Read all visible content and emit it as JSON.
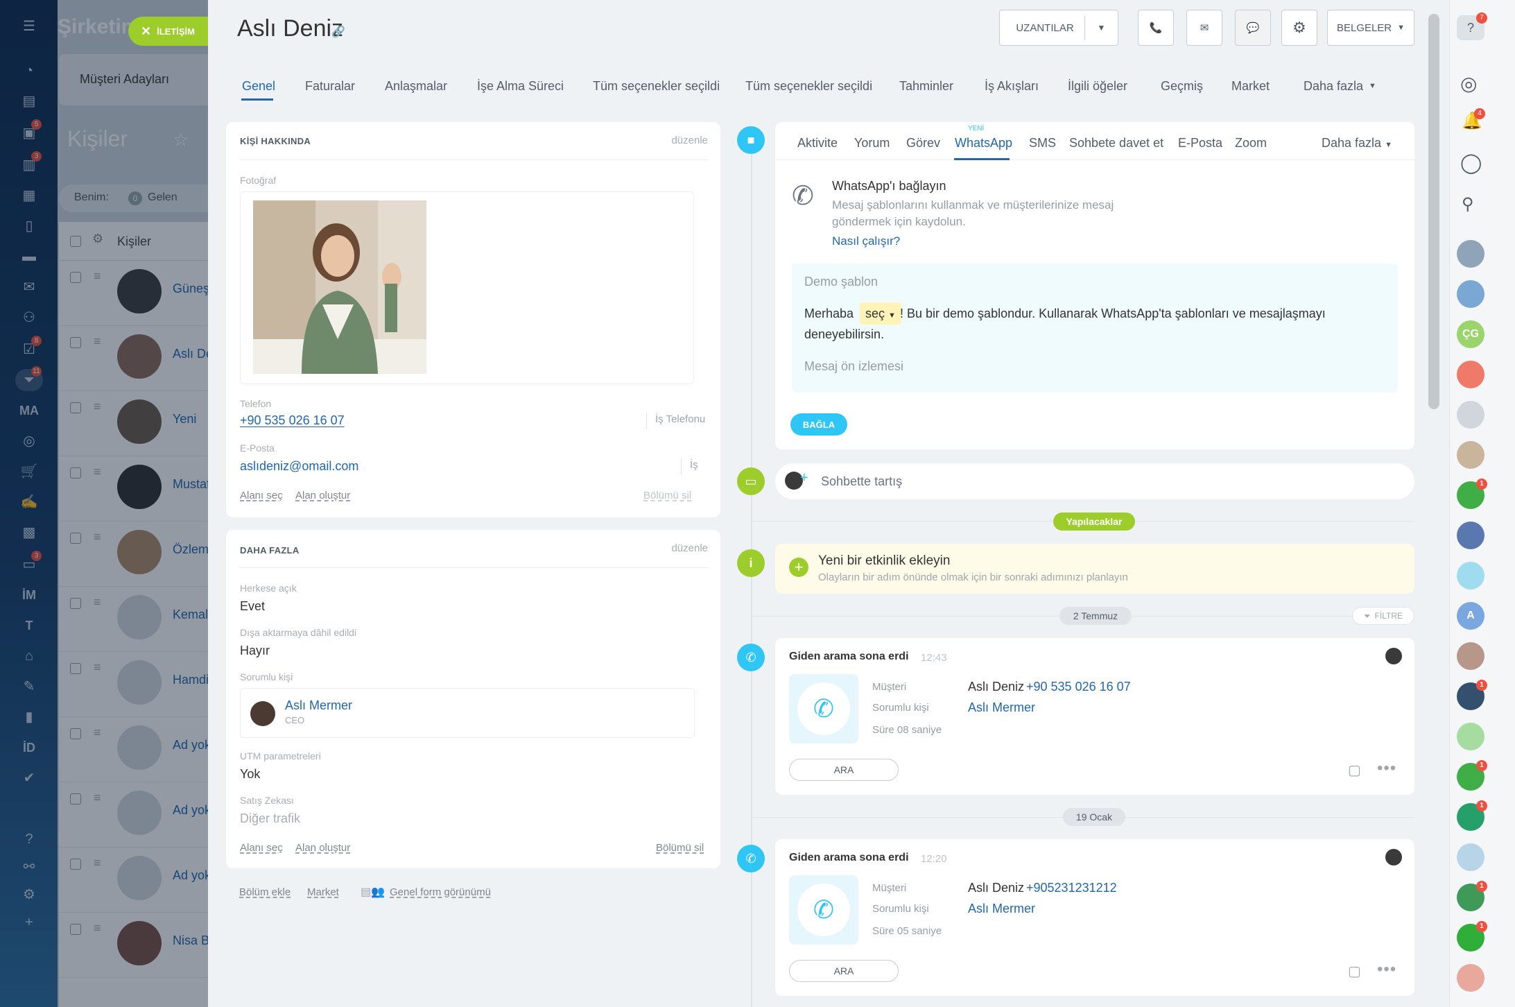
{
  "app": {
    "brand": "Şirketim",
    "contact_badge": "İLETİŞİM"
  },
  "leftnav": {
    "items": [
      {
        "icon": "menu-icon"
      },
      {
        "icon": "pie-chart-icon"
      },
      {
        "icon": "feed-icon"
      },
      {
        "icon": "chat-icon",
        "badge": "5"
      },
      {
        "icon": "contact-card-icon",
        "badge": "3"
      },
      {
        "icon": "calendar-icon"
      },
      {
        "icon": "document-icon"
      },
      {
        "icon": "drive-icon"
      },
      {
        "icon": "mail-icon"
      },
      {
        "icon": "groups-icon"
      },
      {
        "icon": "tasks-icon",
        "badge": "8"
      },
      {
        "icon": "crm-filter-icon",
        "badge": "11"
      },
      {
        "icon": "marketing-icon",
        "text": "MA"
      },
      {
        "icon": "target-icon"
      },
      {
        "icon": "cart-icon"
      },
      {
        "icon": "sign-icon"
      },
      {
        "icon": "box-icon"
      },
      {
        "icon": "inbox-icon",
        "badge": "3"
      },
      {
        "icon": "im-icon",
        "text": "İM"
      },
      {
        "icon": "text-icon",
        "text": "T"
      },
      {
        "icon": "bank-icon"
      },
      {
        "icon": "edit-doc-icon"
      },
      {
        "icon": "analytics-icon"
      },
      {
        "icon": "id-icon",
        "text": "İD"
      },
      {
        "icon": "check-icon"
      },
      {
        "icon": "help-icon"
      },
      {
        "icon": "structure-icon"
      },
      {
        "icon": "settings-icon"
      },
      {
        "icon": "plus-icon"
      }
    ]
  },
  "bgpage": {
    "leads_tab": "Müşteri Adayları",
    "title": "Kişiler",
    "filter_label": "Benim:",
    "filter_count": "0",
    "filter_text": "Gelen",
    "list_header": "Kişiler",
    "rows": [
      "Güneş",
      "Aslı De",
      "Yeni",
      "Mustaf",
      "Özlem",
      "Kemal",
      "Hamdi",
      "Ad yok",
      "Ad yok",
      "Ad yok",
      "Nisa Bu"
    ]
  },
  "header": {
    "title": "Aslı Deniz",
    "btn_extensions": "UZANTILAR",
    "btn_documents": "BELGELER"
  },
  "tabs": [
    "Genel",
    "Faturalar",
    "Anlaşmalar",
    "İşe Alma Süreci",
    "Tüm seçenekler seçildi",
    "Tüm seçenekler seçildi",
    "Tahminler",
    "İş Akışları",
    "İlgili öğeler",
    "Geçmiş",
    "Market",
    "Daha fazla"
  ],
  "about": {
    "title": "KİŞİ HAKKINDA",
    "edit": "düzenle",
    "photo_label": "Fotoğraf",
    "phone_label": "Telefon",
    "phone": "+90 535 026 16 07",
    "phone_type": "İş Telefonu",
    "email_label": "E-Posta",
    "email": "aslıdeniz@omail.com",
    "email_type": "İş",
    "select_field": "Alanı seç",
    "create_field": "Alan oluştur",
    "delete_section": "Bölümü sil"
  },
  "more": {
    "title": "DAHA FAZLA",
    "edit": "düzenle",
    "public_label": "Herkese açık",
    "public_value": "Evet",
    "export_label": "Dışa aktarmaya dâhil edildi",
    "export_value": "Hayır",
    "responsible_label": "Sorumlu kişi",
    "responsible_name": "Aslı Mermer",
    "responsible_role": "CEO",
    "utm_label": "UTM parametreleri",
    "utm_value": "Yok",
    "sales_label": "Satış Zekası",
    "sales_value": "Diğer trafik",
    "select_field": "Alanı seç",
    "create_field": "Alan oluştur",
    "delete_section": "Bölümü sil"
  },
  "footer": {
    "add_section": "Bölüm ekle",
    "market": "Market",
    "form_view": "Genel form görünümü"
  },
  "activity": {
    "tabs": [
      "Aktivite",
      "Yorum",
      "Görev",
      "WhatsApp",
      "SMS",
      "Sohbete davet et",
      "E-Posta",
      "Zoom"
    ],
    "more": "Daha fazla",
    "new_badge": "YENİ",
    "wa_title": "WhatsApp'ı bağlayın",
    "wa_desc_1": "Mesaj şablonlarını kullanmak ve müşterilerinize mesaj",
    "wa_desc_2": "göndermek için kaydolun.",
    "wa_how": "Nasıl çalışır?",
    "demo_label": "Demo şablon",
    "demo_hello": "Merhaba",
    "demo_select": "seç",
    "demo_text_1": "! Bu bir demo şablondur. Kullanarak WhatsApp'ta şablonları ve mesajlaşmayı",
    "demo_text_2": "deneyebilirsin.",
    "preview": "Mesaj ön izlemesi",
    "connect": "BAĞLA"
  },
  "timeline": {
    "chat": "Sohbette tartış",
    "todo_badge": "Yapılacaklar",
    "new_activity_title": "Yeni bir etkinlik ekleyin",
    "new_activity_desc": "Olayların bir adım önünde olmak için bir sonraki adımınızı planlayın",
    "filter": "FİLTRE",
    "calls": [
      {
        "date": "2 Temmuz",
        "title": "Giden arama sona erdi",
        "time": "12:43",
        "client_label": "Müşteri",
        "client": "Aslı Deniz",
        "client_phone": "+90 535 026 16 07",
        "resp_label": "Sorumlu kişi",
        "resp": "Aslı Mermer",
        "duration": "Süre 08 saniye",
        "call_btn": "ARA"
      },
      {
        "date": "19 Ocak",
        "title": "Giden arama sona erdi",
        "time": "12:20",
        "client_label": "Müşteri",
        "client": "Aslı Deniz",
        "client_phone": "+905231231212",
        "resp_label": "Sorumlu kişi",
        "resp": "Aslı Mermer",
        "duration": "Süre 05 saniye",
        "call_btn": "ARA"
      }
    ]
  },
  "rightbar": {
    "help_badge": "7",
    "notif_badge": "4",
    "avatars": [
      {
        "text": "",
        "color": "#8fa4b8"
      },
      {
        "text": "",
        "color": "#7ba7d4"
      },
      {
        "text": "ÇG",
        "color": "#9bd46a"
      },
      {
        "text": "",
        "color": "#f07a6a"
      },
      {
        "text": "",
        "color": "#d0d6dc"
      },
      {
        "text": "",
        "color": "#c9b49c"
      },
      {
        "text": "",
        "color": "#3fae47",
        "badge": "1"
      },
      {
        "text": "",
        "color": "#5a78b0"
      },
      {
        "text": "",
        "color": "#9fdcf0"
      },
      {
        "text": "A",
        "color": "#7aa7e0"
      },
      {
        "text": "",
        "color": "#b7978a"
      },
      {
        "text": "",
        "color": "#34506e",
        "badge": "1"
      },
      {
        "text": "",
        "color": "#a6dca0"
      },
      {
        "text": "",
        "color": "#3fae47",
        "badge": "1"
      },
      {
        "text": "",
        "color": "#25a06a",
        "badge": "1"
      },
      {
        "text": "",
        "color": "#b8d4e8"
      },
      {
        "text": "",
        "color": "#3f9a5a",
        "badge": "1"
      },
      {
        "text": "",
        "color": "#2fae3a",
        "badge": "1"
      },
      {
        "text": "",
        "color": "#e8a89c"
      }
    ]
  }
}
